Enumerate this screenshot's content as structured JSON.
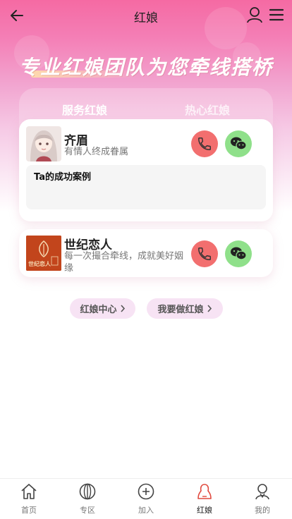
{
  "header": {
    "title": "红娘",
    "back_icon": "arrow-left-icon",
    "user_icon": "user-icon",
    "menu_icon": "hamburger-menu-icon"
  },
  "hero": {
    "slogan": "专业红娘团队为您牵线搭桥"
  },
  "tabs": [
    {
      "label": "服务红娘",
      "active": true
    },
    {
      "label": "热心红娘",
      "active": false
    }
  ],
  "matchmakers": [
    {
      "name": "齐眉",
      "desc": "有情人终成眷属",
      "case_title": "Ta的成功案例"
    },
    {
      "name": "世纪恋人",
      "desc": "每一次撮合牵线，成就美好姻缘",
      "logo_text": "世纪恋人"
    }
  ],
  "actions": {
    "center": "红娘中心",
    "become": "我要做红娘"
  },
  "nav": [
    {
      "label": "首页",
      "icon": "home-icon"
    },
    {
      "label": "专区",
      "icon": "zone-icon"
    },
    {
      "label": "加入",
      "icon": "plus-circle-icon"
    },
    {
      "label": "红娘",
      "icon": "matchmaker-icon",
      "active": true
    },
    {
      "label": "我的",
      "icon": "profile-icon"
    }
  ],
  "colors": {
    "accent_pink": "#f56aa3",
    "call_red": "#f26f6f",
    "wechat_green": "#8fe08a",
    "pill_bg": "#f7e3f4"
  }
}
